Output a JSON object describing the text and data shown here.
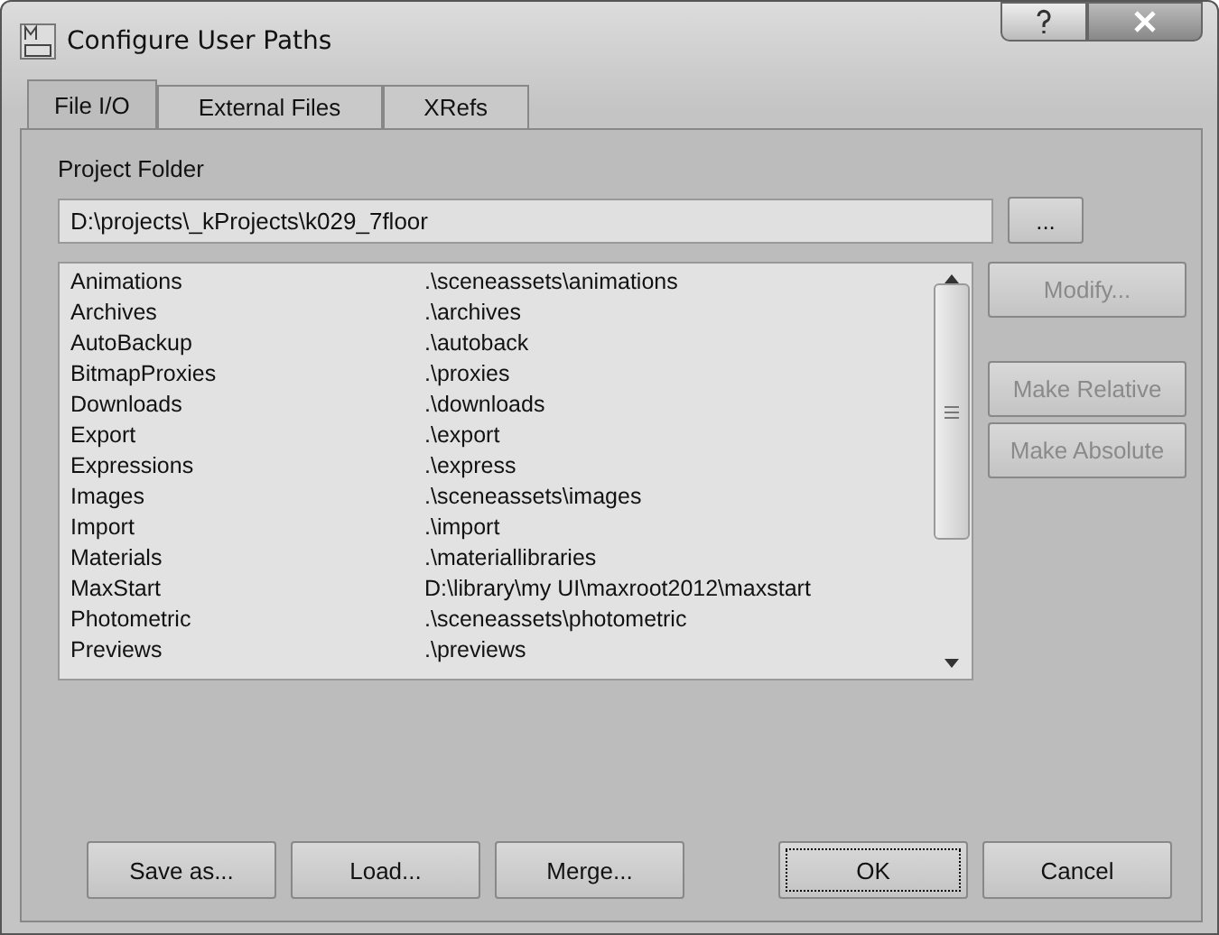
{
  "window": {
    "title": "Configure User Paths"
  },
  "tabs": [
    {
      "label": "File I/O",
      "selected": true
    },
    {
      "label": "External Files",
      "selected": false
    },
    {
      "label": "XRefs",
      "selected": false
    }
  ],
  "project_folder": {
    "label": "Project Folder",
    "value": "D:\\projects\\_kProjects\\k029_7floor",
    "browse_button": "..."
  },
  "paths": [
    {
      "name": "Animations",
      "path": ".\\sceneassets\\animations"
    },
    {
      "name": "Archives",
      "path": ".\\archives"
    },
    {
      "name": "AutoBackup",
      "path": ".\\autoback"
    },
    {
      "name": "BitmapProxies",
      "path": ".\\proxies"
    },
    {
      "name": "Downloads",
      "path": ".\\downloads"
    },
    {
      "name": "Export",
      "path": ".\\export"
    },
    {
      "name": "Expressions",
      "path": ".\\express"
    },
    {
      "name": "Images",
      "path": ".\\sceneassets\\images"
    },
    {
      "name": "Import",
      "path": ".\\import"
    },
    {
      "name": "Materials",
      "path": ".\\materiallibraries"
    },
    {
      "name": "MaxStart",
      "path": "D:\\library\\my UI\\maxroot2012\\maxstart"
    },
    {
      "name": "Photometric",
      "path": ".\\sceneassets\\photometric"
    },
    {
      "name": "Previews",
      "path": ".\\previews"
    }
  ],
  "side_buttons": [
    {
      "label": "Modify...",
      "disabled": true
    },
    {
      "label": "Make Relative",
      "disabled": true
    },
    {
      "label": "Make Absolute",
      "disabled": true
    }
  ],
  "bottom_buttons": [
    {
      "label": "Save as...",
      "focused": false
    },
    {
      "label": "Load...",
      "focused": false
    },
    {
      "label": "Merge...",
      "focused": false
    },
    {
      "label": "OK",
      "focused": true
    },
    {
      "label": "Cancel",
      "focused": false
    }
  ]
}
